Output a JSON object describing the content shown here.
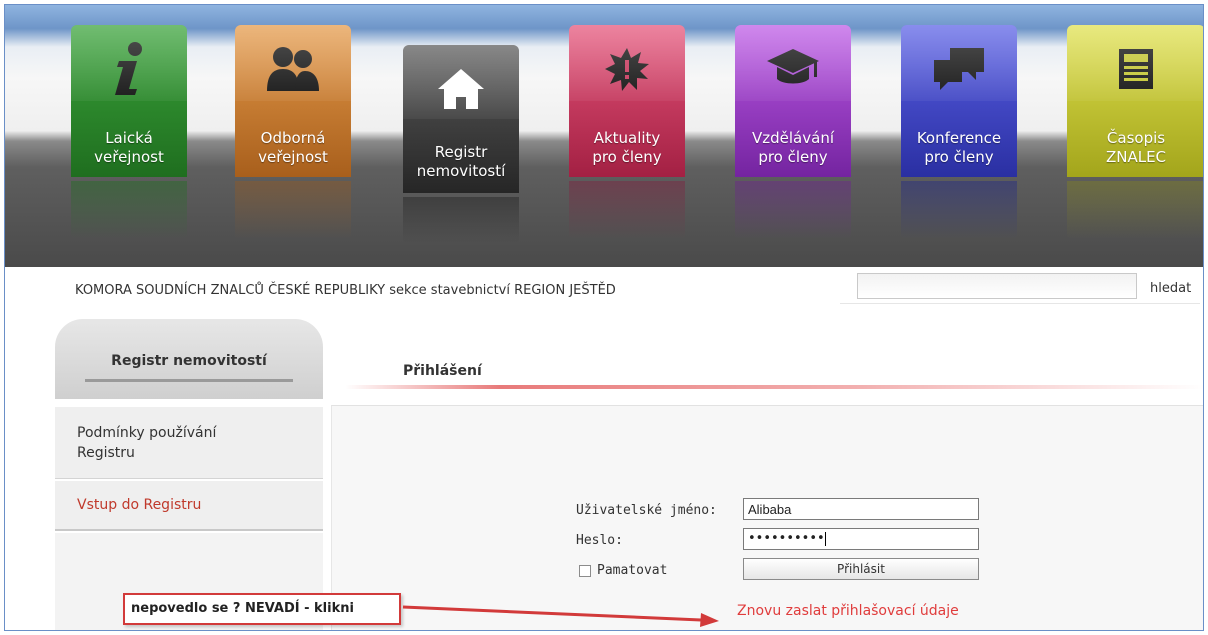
{
  "nav": {
    "tiles": [
      {
        "id": "laicka",
        "label_line1": "Laická",
        "label_line2": "veřejnost",
        "icon": "info-icon",
        "color": "#2e8a2e"
      },
      {
        "id": "odborna",
        "label_line1": "Odborná",
        "label_line2": "veřejnost",
        "icon": "people-icon",
        "color": "#c4792a"
      },
      {
        "id": "registr",
        "label_line1": "Registr",
        "label_line2": "nemovitostí",
        "icon": "home-icon",
        "color": "#3a3a3a",
        "active": true
      },
      {
        "id": "aktuality",
        "label_line1": "Aktuality",
        "label_line2": "pro členy",
        "icon": "burst-icon",
        "color": "#c7345a"
      },
      {
        "id": "vzdelavani",
        "label_line1": "Vzdělávání",
        "label_line2": "pro členy",
        "icon": "graduation-cap-icon",
        "color": "#9b37c4"
      },
      {
        "id": "konference",
        "label_line1": "Konference",
        "label_line2": "pro členy",
        "icon": "chat-icon",
        "color": "#3d43c6"
      },
      {
        "id": "casopis",
        "label_line1": "Časopis",
        "label_line2": "ZNALEC",
        "icon": "newspaper-icon",
        "color": "#c2c42e"
      }
    ]
  },
  "header": {
    "brand": "KOMORA SOUDNÍCH ZNALCŮ ČESKÉ REPUBLIKY sekce stavebnictví REGION JEŠTĚD",
    "search_value": "",
    "search_button": "hledat"
  },
  "sidebar": {
    "title": "Registr nemovitostí",
    "items": [
      {
        "label_line1": "Podmínky používání",
        "label_line2": "Registru"
      },
      {
        "label_line1": "Vstup do Registru",
        "label_line2": ""
      }
    ]
  },
  "login": {
    "tab_title": "Přihlášení",
    "username_label": "Uživatelské jméno:",
    "username_value": "Alibaba",
    "password_label": "Heslo:",
    "password_value": "••••••••••",
    "remember_label": "Pamatovat",
    "submit_label": "Přihlásit",
    "resend_link": "Znovu zaslat přihlašovací údaje"
  },
  "annotation": {
    "callout_text": "nepovedlo se ? NEVADÍ - klikni",
    "callout_color": "#d23a3a"
  }
}
